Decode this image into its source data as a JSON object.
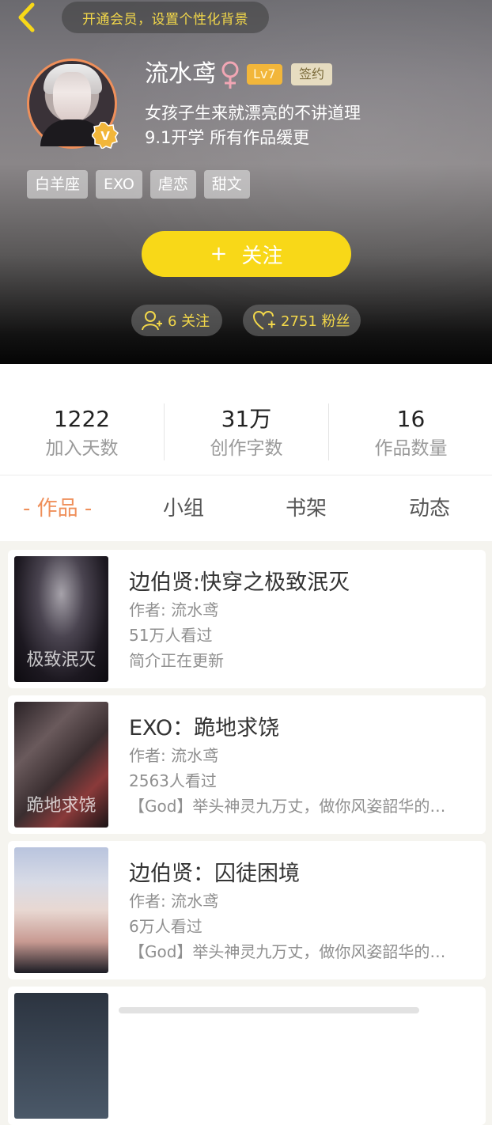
{
  "header": {
    "vip_banner": "开通会员，设置个性化背景",
    "username": "流水鸢",
    "level": "Lv7",
    "sign_badge": "签约",
    "bio_line1": "女孩子生来就漂亮的不讲道理",
    "bio_line2": "9.1开学 所有作品缓更",
    "tags": [
      "白羊座",
      "EXO",
      "虐恋",
      "甜文"
    ],
    "follow_button": {
      "plus": "+",
      "label": "关注"
    },
    "following": "6 关注",
    "fans": "2751 粉丝",
    "colors": {
      "accent_yellow": "#f8d818",
      "verified": "#f2b63a",
      "female": "#f1a6b4"
    }
  },
  "stats": [
    {
      "value": "1222",
      "label": "加入天数"
    },
    {
      "value": "31万",
      "label": "创作字数"
    },
    {
      "value": "16",
      "label": "作品数量"
    }
  ],
  "tabs": [
    {
      "label": "- 作品 -",
      "active": true
    },
    {
      "label": "小组",
      "active": false
    },
    {
      "label": "书架",
      "active": false
    },
    {
      "label": "动态",
      "active": false
    }
  ],
  "books": [
    {
      "title": "边伯贤:快穿之极致泯灭",
      "author": "作者: 流水鸢",
      "views": "51万人看过",
      "intro": "简介正在更新",
      "cover_text": "极致泯灭"
    },
    {
      "title": "EXO：跪地求饶",
      "author": "作者: 流水鸢",
      "views": "2563人看过",
      "intro": "【God】举头神灵九万丈，做你风姿韶华的…",
      "cover_text": "跪地求饶"
    },
    {
      "title": "边伯贤：囚徒困境",
      "author": "作者: 流水鸢",
      "views": "6万人看过",
      "intro": "【God】举头神灵九万丈，做你风姿韶华的…",
      "cover_text": ""
    }
  ]
}
